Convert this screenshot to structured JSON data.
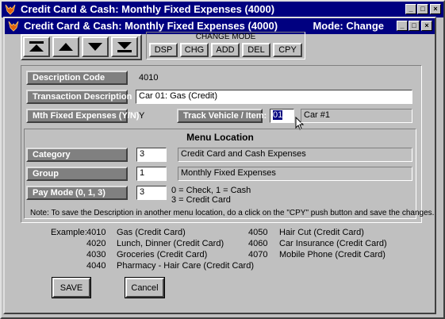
{
  "outer_window": {
    "title": "Credit Card & Cash: Monthly Fixed Expenses (4000)"
  },
  "inner_window": {
    "title": "Credit Card & Cash: Monthly Fixed Expenses (4000)",
    "mode_label": "Mode: Change"
  },
  "change_mode": {
    "label": "CHANGE MODE",
    "buttons": [
      "DSP",
      "CHG",
      "ADD",
      "DEL",
      "CPY"
    ]
  },
  "form": {
    "description_code": {
      "label": "Description Code",
      "value": "4010"
    },
    "transaction_description": {
      "label": "Transaction Description",
      "value": "Car 01: Gas  (Credit)"
    },
    "mth_fixed_expenses": {
      "label": "Mth Fixed Expenses (Y/N)",
      "value": "Y"
    },
    "track_vehicle": {
      "label": "Track Vehicle / Item:",
      "value": "01",
      "display": "Car #1"
    }
  },
  "menu_location": {
    "title": "Menu Location",
    "category": {
      "label": "Category",
      "value": "3",
      "display": "Credit Card and Cash Expenses"
    },
    "group": {
      "label": "Group",
      "value": "1",
      "display": "Monthly Fixed Expenses"
    },
    "pay_mode": {
      "label": "Pay Mode",
      "range": "(0, 1, 3)",
      "value": "3",
      "hint1": "0 = Check, 1 = Cash",
      "hint2": "3 = Credit Card"
    },
    "note": "Note: To save the Description in another menu location, do a click on the \"CPY\" push button and save the changes."
  },
  "examples": {
    "label": "Example:",
    "left": [
      {
        "code": "4010",
        "desc": "Gas  (Credit Card)"
      },
      {
        "code": "4020",
        "desc": "Lunch, Dinner  (Credit Card)"
      },
      {
        "code": "4030",
        "desc": "Groceries  (Credit Card)"
      },
      {
        "code": "4040",
        "desc": "Pharmacy - Hair Care  (Credit Card)"
      }
    ],
    "right": [
      {
        "code": "4050",
        "desc": "Hair Cut  (Credit Card)"
      },
      {
        "code": "4060",
        "desc": "Car Insurance  (Credit Card)"
      },
      {
        "code": "4070",
        "desc": "Mobile Phone  (Credit Card)"
      }
    ]
  },
  "actions": {
    "save": "SAVE",
    "cancel": "Cancel"
  },
  "colors": {
    "title_bar": "#000080",
    "face": "#c0c0c0",
    "label_bg": "#808080"
  },
  "window_controls": {
    "minimize": "_",
    "maximize": "□",
    "close": "×"
  }
}
